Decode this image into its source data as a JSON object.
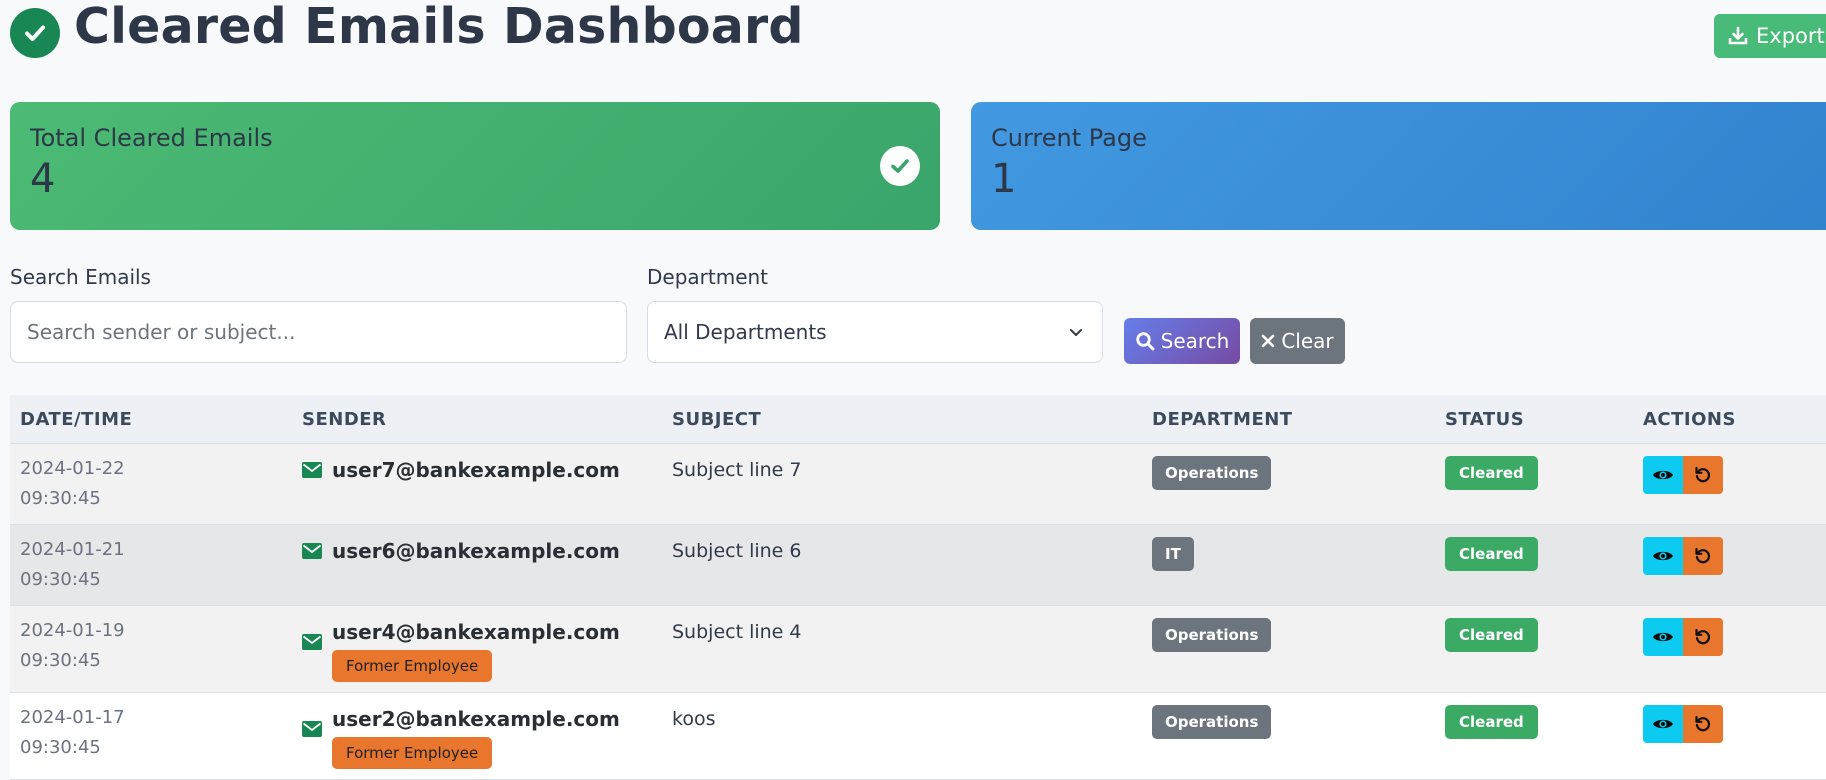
{
  "header": {
    "title": "Cleared Emails Dashboard",
    "export_label": "Export to"
  },
  "stats": {
    "total": {
      "label": "Total Cleared Emails",
      "value": "4"
    },
    "page": {
      "label": "Current Page",
      "value": "1"
    }
  },
  "filters": {
    "search_label": "Search Emails",
    "search_placeholder": "Search sender or subject...",
    "department_label": "Department",
    "department_value": "All Departments",
    "search_button": "Search",
    "clear_button": "Clear"
  },
  "table": {
    "columns": [
      "DATE/TIME",
      "SENDER",
      "SUBJECT",
      "DEPARTMENT",
      "STATUS",
      "ACTIONS"
    ],
    "rows": [
      {
        "date": "2024-01-22",
        "time": "09:30:45",
        "sender": "user7@bankexample.com",
        "former": "",
        "subject": "Subject line 7",
        "department": "Operations",
        "status": "Cleared"
      },
      {
        "date": "2024-01-21",
        "time": "09:30:45",
        "sender": "user6@bankexample.com",
        "former": "",
        "subject": "Subject line 6",
        "department": "IT",
        "status": "Cleared"
      },
      {
        "date": "2024-01-19",
        "time": "09:30:45",
        "sender": "user4@bankexample.com",
        "former": "Former Employee",
        "subject": "Subject line 4",
        "department": "Operations",
        "status": "Cleared"
      },
      {
        "date": "2024-01-17",
        "time": "09:30:45",
        "sender": "user2@bankexample.com",
        "former": "Former Employee",
        "subject": "koos",
        "department": "Operations",
        "status": "Cleared"
      }
    ]
  },
  "colors": {
    "success": "#48bb78",
    "primary": "#4299e1",
    "info": "#0dcaf0",
    "warning": "#e8762d",
    "secondary": "#6c757d"
  },
  "icons": [
    "check-circle-icon",
    "download-icon",
    "search-icon",
    "close-icon",
    "chevron-down-icon",
    "envelope-icon",
    "eye-icon",
    "undo-icon"
  ]
}
